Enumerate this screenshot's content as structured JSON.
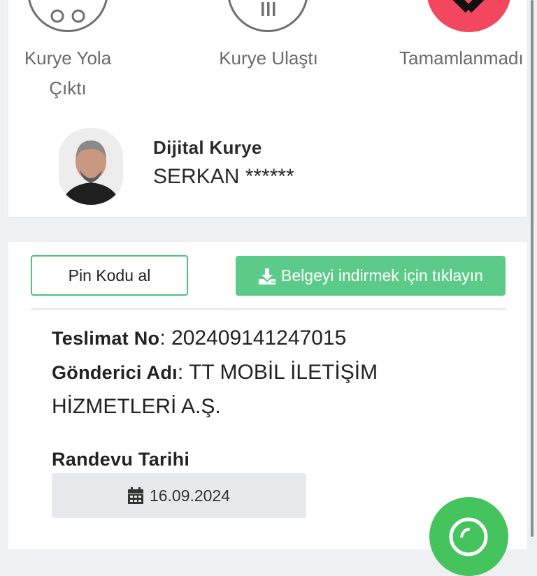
{
  "status_steps": [
    {
      "label_line1": "Kurye Yola",
      "label_line2": "Çıktı"
    },
    {
      "label_line1": "Kurye Ulaştı"
    },
    {
      "label_line1": "Tamamlanmadı"
    }
  ],
  "courier": {
    "title": "Dijital Kurye",
    "name": "SERKAN ******"
  },
  "actions": {
    "pin_label": "Pin Kodu al",
    "download_label": "Belgeyi indirmek için tıklayın"
  },
  "delivery": {
    "number_label": "Teslimat No",
    "number_value": "202409141247015",
    "sender_label": "Gönderici Adı",
    "sender_value_line1": "TT MOBİL İLETİŞİM",
    "sender_value_line2": "HİZMETLERİ A.Ş.",
    "appointment_label": "Randevu Tarihi",
    "appointment_date": "16.09.2024"
  },
  "colors": {
    "accent_green": "#5ccb8a",
    "failed_red": "#f2475e",
    "whatsapp_green": "#45c35c"
  },
  "icons": {
    "step1": "route-icon",
    "step2": "building-icon",
    "step3": "x-icon",
    "download": "download-icon",
    "date": "calendar-icon",
    "chat": "whatsapp-icon"
  }
}
